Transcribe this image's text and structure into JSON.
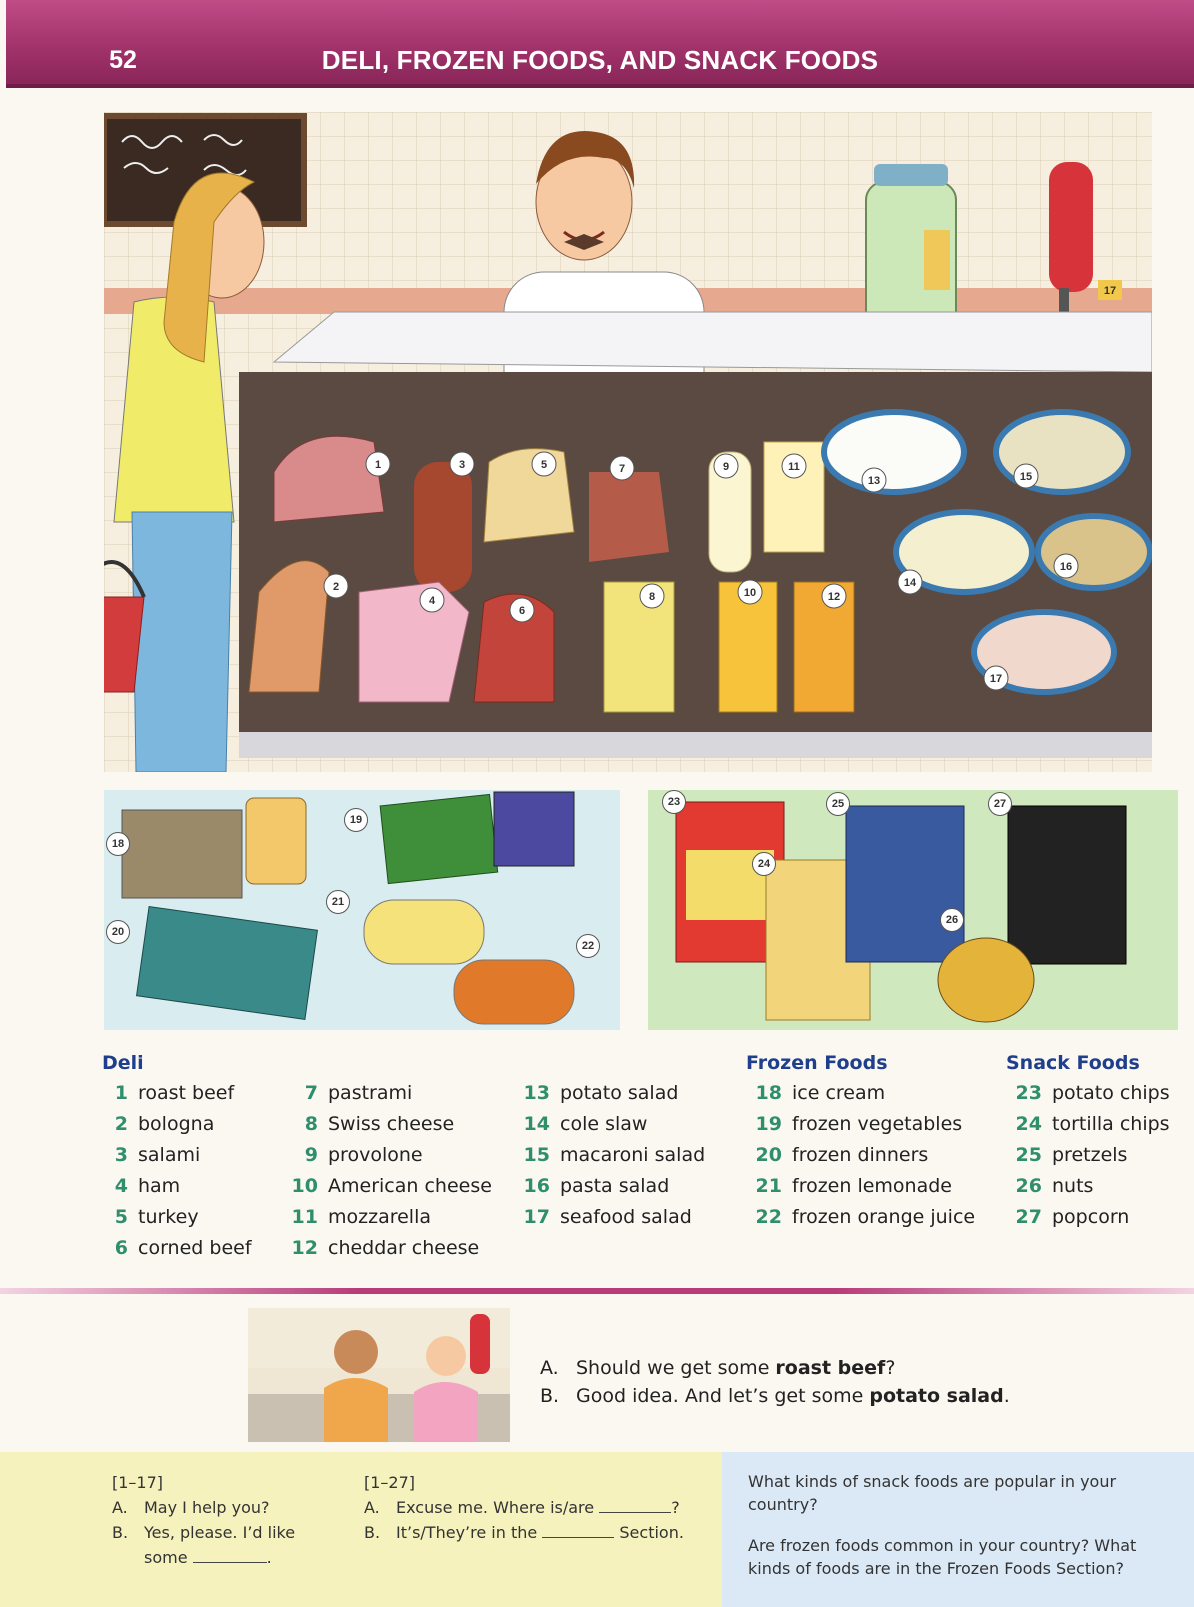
{
  "header": {
    "page_number": "52",
    "title": "DELI, FROZEN FOODS, AND SNACK FOODS"
  },
  "colors": {
    "banner": "#a2336b",
    "heading_blue": "#1f3f8c",
    "number_green": "#2f8f6d"
  },
  "scene": {
    "deli_counter_numbers": [
      "1",
      "2",
      "3",
      "4",
      "5",
      "6",
      "7",
      "8",
      "9",
      "10",
      "11",
      "12",
      "13",
      "14",
      "15",
      "16",
      "17"
    ],
    "frozen_numbers": [
      "18",
      "19",
      "20",
      "21",
      "22"
    ],
    "snack_numbers": [
      "23",
      "24",
      "25",
      "26",
      "27"
    ]
  },
  "deli": {
    "heading": "Deli",
    "col1": [
      {
        "num": "1",
        "word": "roast beef"
      },
      {
        "num": "2",
        "word": "bologna"
      },
      {
        "num": "3",
        "word": "salami"
      },
      {
        "num": "4",
        "word": "ham"
      },
      {
        "num": "5",
        "word": "turkey"
      },
      {
        "num": "6",
        "word": "corned beef"
      }
    ],
    "col2": [
      {
        "num": "7",
        "word": "pastrami"
      },
      {
        "num": "8",
        "word": "Swiss cheese"
      },
      {
        "num": "9",
        "word": "provolone"
      },
      {
        "num": "10",
        "word": "American cheese"
      },
      {
        "num": "11",
        "word": "mozzarella"
      },
      {
        "num": "12",
        "word": "cheddar cheese"
      }
    ],
    "col3": [
      {
        "num": "13",
        "word": "potato salad"
      },
      {
        "num": "14",
        "word": "cole slaw"
      },
      {
        "num": "15",
        "word": "macaroni salad"
      },
      {
        "num": "16",
        "word": "pasta salad"
      },
      {
        "num": "17",
        "word": "seafood salad"
      }
    ]
  },
  "frozen": {
    "heading": "Frozen Foods",
    "items": [
      {
        "num": "18",
        "word": "ice cream"
      },
      {
        "num": "19",
        "word": "frozen vegetables"
      },
      {
        "num": "20",
        "word": "frozen dinners"
      },
      {
        "num": "21",
        "word": "frozen lemonade"
      },
      {
        "num": "22",
        "word": "frozen orange juice"
      }
    ]
  },
  "snack": {
    "heading": "Snack Foods",
    "items": [
      {
        "num": "23",
        "word": "potato chips"
      },
      {
        "num": "24",
        "word": "tortilla chips"
      },
      {
        "num": "25",
        "word": "pretzels"
      },
      {
        "num": "26",
        "word": "nuts"
      },
      {
        "num": "27",
        "word": "popcorn"
      }
    ]
  },
  "conversation": {
    "a_label": "A.",
    "a_pre": "Should we get some ",
    "a_bold": "roast beef",
    "a_post": "?",
    "b_label": "B.",
    "b_pre": "Good idea.  And let’s get some ",
    "b_bold": "potato salad",
    "b_post": "."
  },
  "practice1": {
    "range": "[1–17]",
    "a_label": "A.",
    "a_text": "May I help you?",
    "b_label": "B.",
    "b_text": "Yes, please.  I’d like",
    "b_text2": "some",
    "b_end": "."
  },
  "practice2": {
    "range": "[1–27]",
    "a_label": "A.",
    "a_text": "Excuse me.  Where is/are",
    "a_end": "?",
    "b_label": "B.",
    "b_text": "It’s/They’re in the",
    "b_end": "Section."
  },
  "questions": {
    "q1": "What kinds of snack foods are popular in your country?",
    "q2": "Are frozen foods common in your country? What kinds of foods are in the Frozen Foods Section?"
  }
}
